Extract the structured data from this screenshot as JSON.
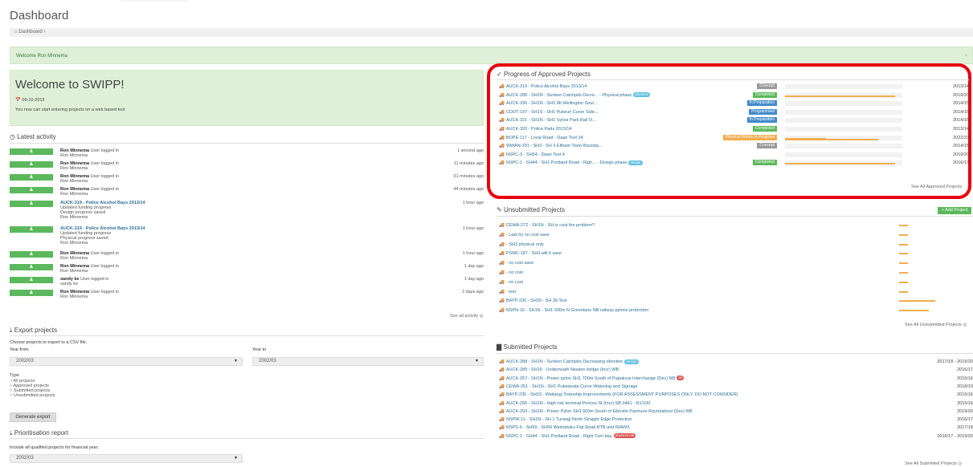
{
  "header": {
    "title": "Dashboard",
    "breadcrumb": "Dashboard ›"
  },
  "welcome_bar": "Welcome Ron Minnema",
  "welcome_panel": {
    "title": "Welcome to SWIPP!",
    "date": "09-10-2015",
    "text": "You now can start entering projects on a web based tool"
  },
  "activity": {
    "title": "Latest activity",
    "items": [
      {
        "user": "Ron Minnema",
        "action": "User logged in",
        "lines": [
          "Ron Minnema"
        ],
        "time": "1 second ago"
      },
      {
        "user": "Ron Minnema",
        "action": "User logged in",
        "lines": [
          "Ron Minnema"
        ],
        "time": "11 minutes ago"
      },
      {
        "user": "Ron Minnema",
        "action": "User logged in",
        "lines": [
          "Ron Minnema"
        ],
        "time": "31 minutes ago"
      },
      {
        "user": "Ron Minnema",
        "action": "User logged in",
        "lines": [
          "Ron Minnema"
        ],
        "time": "44 minutes ago"
      },
      {
        "user": "AUCK-319 - Police Alcohol Bays 2013/14",
        "action": "",
        "lines": [
          "Updated funding progress",
          "Design progress saved",
          "Ron Minnema"
        ],
        "time": "1 hour ago"
      },
      {
        "user": "AUCK-319 - Police Alcohol Bays 2013/14",
        "action": "",
        "lines": [
          "Updated funding progress",
          "Physical progress saved",
          "Ron Minnema"
        ],
        "time": "1 hour ago"
      },
      {
        "user": "Ron Minnema",
        "action": "User logged in",
        "lines": [
          "Ron Minnema"
        ],
        "time": "1 hour ago"
      },
      {
        "user": "Ron Minnema",
        "action": "User logged in",
        "lines": [
          "Ron Minnema"
        ],
        "time": "1 day ago"
      },
      {
        "user": "sandy ke",
        "action": "User logged in",
        "lines": [
          "sandy ke"
        ],
        "time": "1 day ago"
      },
      {
        "user": "Ron Minnema",
        "action": "User logged in",
        "lines": [
          "Ron Minnema"
        ],
        "time": "2 days ago"
      }
    ],
    "see_all": "See all activity"
  },
  "export": {
    "title": "Export projects",
    "hint": "Choose projects to export to a CSV file.",
    "year_from_label": "Year from",
    "year_from": "2002/03",
    "year_to_label": "Year to",
    "year_to": "2002/03",
    "type_label": "Type",
    "types": [
      "All projects",
      "Approved projects",
      "Submitted projects",
      "Unsubmitted projects"
    ],
    "button": "Generate export"
  },
  "prioritisation": {
    "title": "Prioritisation report",
    "hint": "Include all qualified projects for financial year:",
    "year": "2002/03"
  },
  "approved": {
    "title": "Progress of Approved Projects",
    "see_all": "See All Approved Projects",
    "rows": [
      {
        "name": "AUCK-319 - Police Alcohol Bays 2013/14",
        "tag": "",
        "status": "Concept",
        "color": "#999999",
        "progress": 0,
        "progress2": 0,
        "year": "2013/14"
      },
      {
        "name": "AUCK-288 - SH1N - Sunken Catchpits Decre... - Physical phase",
        "tag": "physical",
        "status": "Completed",
        "color": "#5cb85c",
        "progress": 1,
        "progress2": 0,
        "year": "2019/20"
      },
      {
        "name": "AUCK-336 - SH1N - SH1 Mt Wellington Sout...",
        "tag": "",
        "status": "In Preparation",
        "color": "#428bca",
        "progress": 0,
        "progress2": 0,
        "year": "2014/15"
      },
      {
        "name": "CDOT-197 - SH1S - SH1 Pukeuri Curve Side...",
        "tag": "",
        "status": "Programmed",
        "color": "#428bca",
        "progress": 0,
        "progress2": 0,
        "year": "2014/15"
      },
      {
        "name": "AUCK-321 - SH1N - SH1 Sylvia Park Rail O...",
        "tag": "",
        "status": "In Preparation",
        "color": "#428bca",
        "progress": 0,
        "progress2": 0,
        "year": "2014/15"
      },
      {
        "name": "AUCK-320 - Police Pads 2013/14",
        "tag": "",
        "status": "Completed",
        "color": "#5cb85c",
        "progress": 0,
        "progress2": 0,
        "year": "2013/14"
      },
      {
        "name": "BOPE-117 - Local Road - Daan Test 34",
        "tag": "",
        "status": "Physical Works In Progress",
        "color": "#f0ad4e",
        "progress": 0.37,
        "progress2": 0.85,
        "year": "2022/23"
      },
      {
        "name": "WWAN-291 - SH3 - SH 3 Eltham Town Bounda...",
        "tag": "",
        "status": "Concept",
        "color": "#999999",
        "progress": 0,
        "progress2": 0,
        "year": "2014/15"
      },
      {
        "name": "NSPC-3 - SH54 - Daan Test 4",
        "tag": "",
        "status": "",
        "color": "",
        "progress": 0,
        "progress2": 0,
        "year": "2019/20"
      },
      {
        "name": "NSPC-1 - SH44 - SH1 Portland Road - Righ... - Design phase",
        "tag": "design",
        "status": "Completed",
        "color": "#5cb85c",
        "progress": 1,
        "progress2": 0,
        "year": "2016/17"
      }
    ]
  },
  "unsubmitted": {
    "title": "Unsubmitted Projects",
    "add_button": "+ Add Project",
    "see_all": "See All Unsubmitted Projects",
    "rows": [
      {
        "name": "CEWA-272 - SH1N - SH is cost the problem?",
        "progress": 0.13
      },
      {
        "name": "- Last try no cost save",
        "progress": 0.13
      },
      {
        "name": "- SH3 physical only",
        "progress": 0.13
      },
      {
        "name": "PSMC-187 - SH3 will it save",
        "progress": 0.13
      },
      {
        "name": "- no cost save",
        "progress": 0.13
      },
      {
        "name": "- no cost",
        "progress": 0.13
      },
      {
        "name": "- no cost",
        "progress": 0.13
      },
      {
        "name": "- test",
        "progress": 0.13
      },
      {
        "name": "BAYP-236 - SH39 - SH 39 Test",
        "progress": 0.52
      },
      {
        "name": "NSPN-16 - SH1N - SH1 300m N Greenlane NB railway pylons protection",
        "progress": 0.42
      }
    ]
  },
  "submitted": {
    "title": "Submitted Projects",
    "see_all": "See All Submitted Projects",
    "rows": [
      {
        "name": "AUCK-288 - SH1N - Sunken Catchpits Decreasing direction",
        "tag": "design",
        "tag_color": "#5bc0de",
        "icon_color": "#5cb85c",
        "year": "2017/18 - 2019/20"
      },
      {
        "name": "AUCK-289 - SH16 - Underneath Newton bridge (Incr) WB",
        "tag": "",
        "tag_color": "",
        "icon_color": "#f0ad4e",
        "year": "2016/17"
      },
      {
        "name": "AUCK-257 - SH1N - Power pylon SH1 700m South of Papakura Interchange (Dec) NB",
        "tag": "all",
        "tag_color": "#d9534f",
        "icon_color": "#d9534f",
        "year": "2015/16"
      },
      {
        "name": "CEWA-261 - SH1N - SH1 Puketarata Curve Widening and Signage",
        "tag": "",
        "tag_color": "",
        "icon_color": "#5cb85c",
        "year": "2018/19"
      },
      {
        "name": "BAYP-235 - SH33 - Waitangi Township Improvements (FOR ASSESSMENT PURPOSES ONLY. DO NOT CONSIDER)",
        "tag": "",
        "tag_color": "",
        "icon_color": "#5cb85c",
        "year": "2015/16"
      },
      {
        "name": "AUCK-295 - SH1N - High risk terminal Princes St (Incr) SB 0441 - R1/100",
        "tag": "",
        "tag_color": "",
        "icon_color": "#5cb85c",
        "year": "2015/16"
      },
      {
        "name": "AUCK-293 - SH1N - Power Pylon SH1 600m South of Ellerslie Panmure Roundabout (Dec) NB",
        "tag": "",
        "tag_color": "",
        "icon_color": "#5cb85c",
        "year": "2019/20"
      },
      {
        "name": "NSPW-11 - SH1N - SH 1 Turangi North Straight Edge Protection",
        "tag": "",
        "tag_color": "",
        "icon_color": "#5cb85c",
        "year": "2016/17"
      },
      {
        "name": "NSPS-6 - SH99 - SH99 Waimatuku Flat Road RTB and RIAWS",
        "tag": "",
        "tag_color": "",
        "icon_color": "#5cb85c",
        "year": "2017/18"
      },
      {
        "name": "NSPC-1 - SH44 - SH1 Portland Road - Right Turn bay",
        "tag": "physical rsk",
        "tag_color": "#d9534f",
        "icon_color": "#5cb85c",
        "year": "2016/17 - 2019/20"
      }
    ]
  },
  "highlight_color": "#e8000b"
}
